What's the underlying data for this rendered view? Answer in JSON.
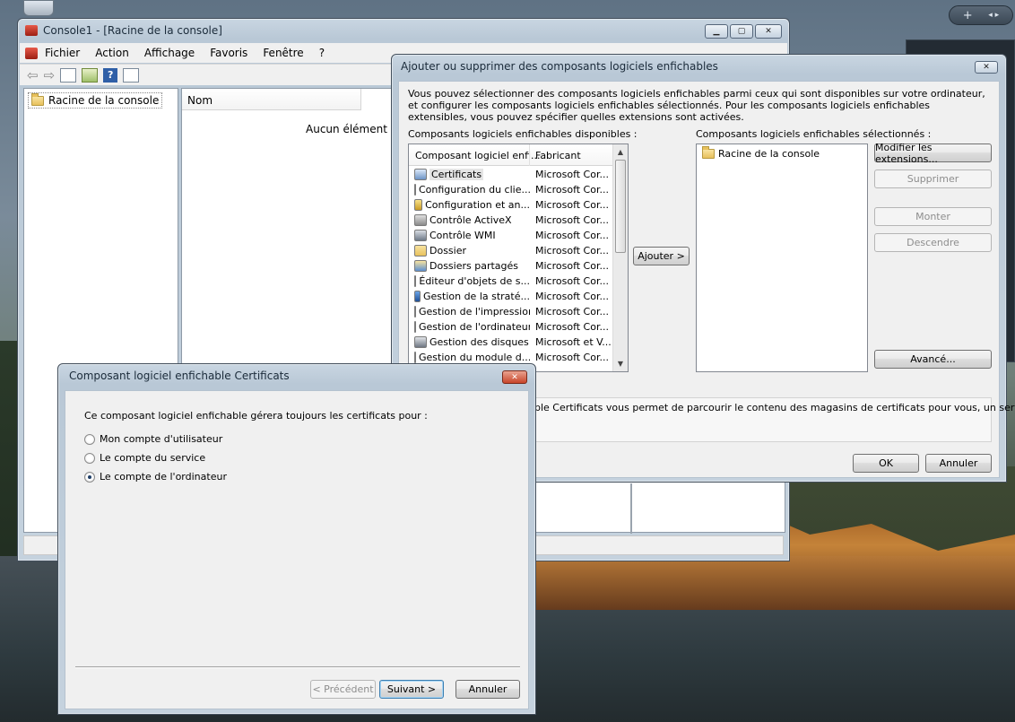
{
  "desktop": {
    "sidebar_plus": "+",
    "sidebar_arrows": "◂ ▸"
  },
  "console": {
    "title": "Console1 - [Racine de la console]",
    "menu": [
      "Fichier",
      "Action",
      "Affichage",
      "Favoris",
      "Fenêtre",
      "?"
    ],
    "tree_root": "Racine de la console",
    "column_name": "Nom",
    "empty_text": "Aucun élément à a"
  },
  "addremove": {
    "title": "Ajouter ou supprimer des composants logiciels enfichables",
    "description": "Vous pouvez sélectionner des composants logiciels enfichables parmi ceux qui sont disponibles sur votre ordinateur, et configurer les composants logiciels enfichables sélectionnés. Pour les composants logiciels enfichables extensibles, vous pouvez spécifier quelles extensions sont activées.",
    "available_label": "Composants logiciels enfichables disponibles :",
    "selected_label": "Composants logiciels enfichables sélectionnés :",
    "col_snapin": "Composant logiciel enfi...",
    "col_vendor": "Fabricant",
    "snapins": [
      {
        "name": "Certificats",
        "vendor": "Microsoft Cor...",
        "icon": "certificate-icon"
      },
      {
        "name": "Configuration du clie...",
        "vendor": "Microsoft Cor...",
        "icon": "client-config-icon"
      },
      {
        "name": "Configuration et an...",
        "vendor": "Microsoft Cor...",
        "icon": "security-config-icon"
      },
      {
        "name": "Contrôle ActiveX",
        "vendor": "Microsoft Cor...",
        "icon": "activex-icon"
      },
      {
        "name": "Contrôle WMI",
        "vendor": "Microsoft Cor...",
        "icon": "wmi-icon"
      },
      {
        "name": "Dossier",
        "vendor": "Microsoft Cor...",
        "icon": "folder-icon"
      },
      {
        "name": "Dossiers partagés",
        "vendor": "Microsoft Cor...",
        "icon": "shared-folders-icon"
      },
      {
        "name": "Éditeur d'objets de s...",
        "vendor": "Microsoft Cor...",
        "icon": "gpo-editor-icon"
      },
      {
        "name": "Gestion de la straté...",
        "vendor": "Microsoft Cor...",
        "icon": "policy-management-icon"
      },
      {
        "name": "Gestion de l'impression",
        "vendor": "Microsoft Cor...",
        "icon": "print-management-icon"
      },
      {
        "name": "Gestion de l'ordinateur",
        "vendor": "Microsoft Cor...",
        "icon": "computer-management-icon"
      },
      {
        "name": "Gestion des disques",
        "vendor": "Microsoft et V...",
        "icon": "disk-management-icon"
      },
      {
        "name": "Gestion du module d...",
        "vendor": "Microsoft Cor...",
        "icon": "tpm-management-icon"
      }
    ],
    "add_button": "Ajouter >",
    "selected_root": "Racine de la console",
    "modify_extensions": "Modifier les extensions...",
    "remove": "Supprimer",
    "move_up": "Monter",
    "move_down": "Descendre",
    "advanced": "Avancé...",
    "description_box": "ble Certificats vous permet de parcourir le contenu des magasins de certificats pour vous, un service ou",
    "ok": "OK",
    "cancel": "Annuler"
  },
  "certdialog": {
    "title": "Composant logiciel enfichable Certificats",
    "prompt": "Ce composant logiciel enfichable gérera toujours les certificats pour :",
    "options": [
      {
        "label": "Mon compte d'utilisateur",
        "checked": false
      },
      {
        "label": "Le compte du service",
        "checked": false
      },
      {
        "label": "Le compte de l'ordinateur",
        "checked": true
      }
    ],
    "back": "< Précédent",
    "next": "Suivant >",
    "cancel": "Annuler"
  }
}
